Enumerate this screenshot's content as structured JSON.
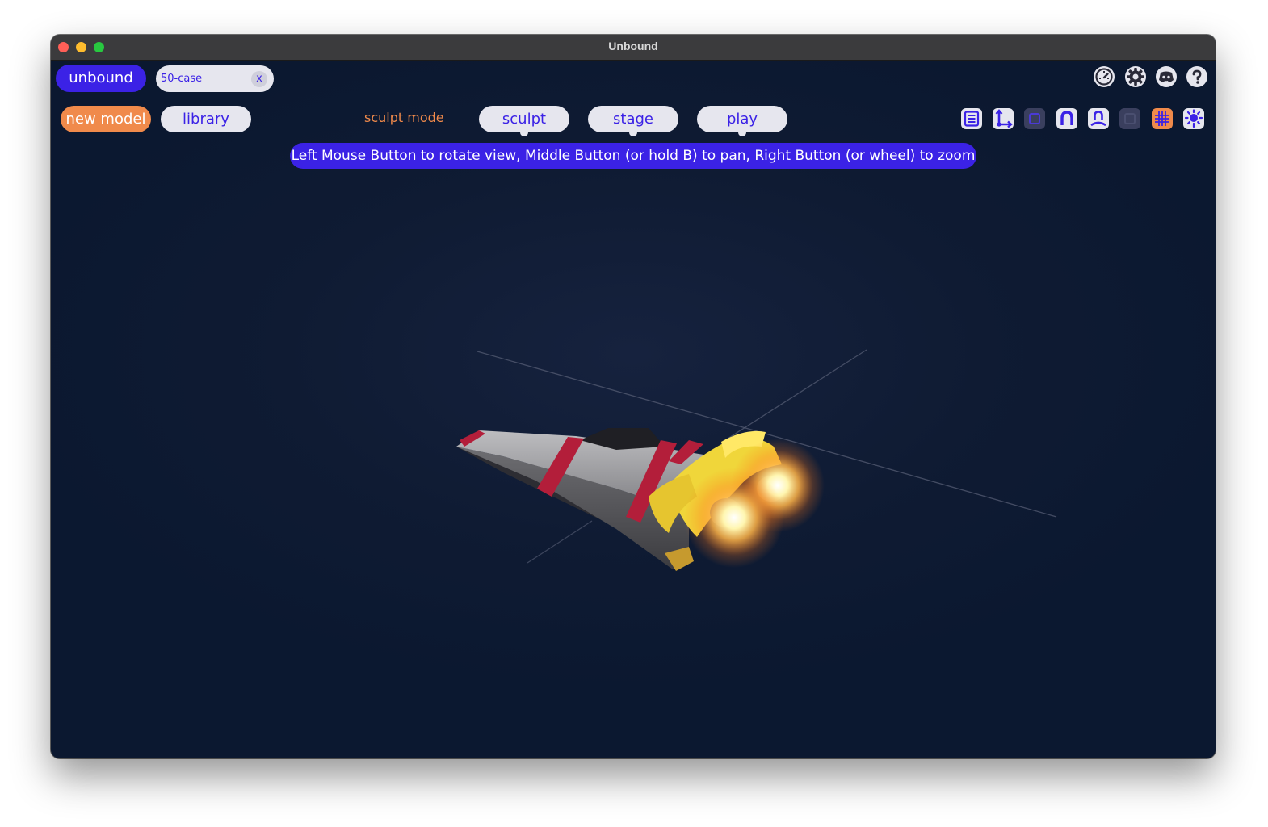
{
  "window": {
    "title": "Unbound"
  },
  "header": {
    "brand_label": "unbound",
    "document_tab": {
      "name": "50-case",
      "close_label": "x"
    },
    "icons": [
      "gauge-icon",
      "gear-icon",
      "discord-icon",
      "help-icon"
    ]
  },
  "toolbar": {
    "new_model_label": "new model",
    "library_label": "library",
    "mode_label": "sculpt mode",
    "tabs": [
      {
        "label": "sculpt"
      },
      {
        "label": "stage"
      },
      {
        "label": "play"
      }
    ],
    "tools": [
      "list-icon",
      "axis-icon",
      "box-icon",
      "magnet-icon",
      "pin-icon",
      "box-outline-icon",
      "grid-icon",
      "light-icon"
    ],
    "hint": "Left Mouse Button to rotate view, Middle Button (or hold B) to pan, Right Button (or wheel) to zoom"
  },
  "colors": {
    "accent": "#3b22e6",
    "orange": "#f08a4b",
    "pill_bg": "#e6e6ee",
    "viewport_bg": "#0f1b33"
  }
}
